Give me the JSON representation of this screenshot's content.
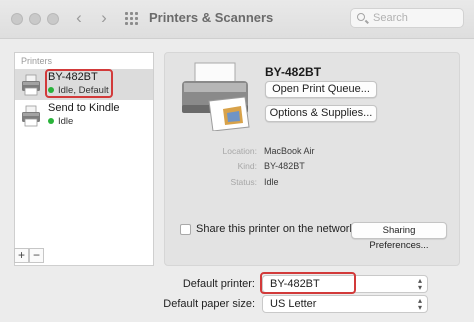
{
  "window": {
    "title": "Printers & Scanners",
    "search_placeholder": "Search"
  },
  "printer_list": {
    "header": "Printers",
    "items": [
      {
        "name": "BY-482BT",
        "status": "Idle, Default",
        "status_color": "#29b33a",
        "selected": true
      },
      {
        "name": "Send to Kindle",
        "status": "Idle",
        "status_color": "#29b33a",
        "selected": false
      }
    ],
    "add_label": "+",
    "remove_label": "−"
  },
  "detail": {
    "printer_name": "BY-482BT",
    "open_queue_label": "Open Print Queue...",
    "options_label": "Options & Supplies...",
    "info": [
      {
        "key": "Location:",
        "value": "MacBook Air"
      },
      {
        "key": "Kind:",
        "value": "BY-482BT"
      },
      {
        "key": "Status:",
        "value": "Idle"
      }
    ],
    "share_label": "Share this printer on the network",
    "share_checked": false,
    "sharing_prefs_label": "Sharing Preferences..."
  },
  "defaults": {
    "default_printer_label": "Default printer:",
    "default_printer_value": "BY-482BT",
    "paper_size_label": "Default paper size:",
    "paper_size_value": "US Letter"
  },
  "colors": {
    "highlight_box": "#d23a3a",
    "status_idle": "#29b33a"
  }
}
